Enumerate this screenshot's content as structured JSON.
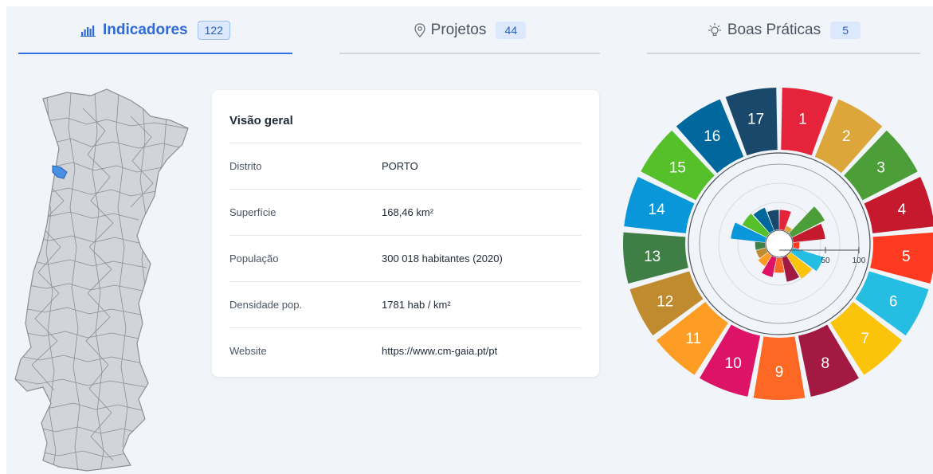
{
  "tabs": [
    {
      "label": "Indicadores",
      "count": "122",
      "icon": "bar-chart-icon",
      "active": true
    },
    {
      "label": "Projetos",
      "count": "44",
      "icon": "location-pin-icon",
      "active": false
    },
    {
      "label": "Boas Práticas",
      "count": "5",
      "icon": "lightbulb-icon",
      "active": false
    }
  ],
  "overview": {
    "title": "Visão geral",
    "rows": [
      {
        "key": "Distrito",
        "value": "PORTO"
      },
      {
        "key": "Superfície",
        "value": "168,46 km²"
      },
      {
        "key": "População",
        "value": "300 018 habitantes (2020)"
      },
      {
        "key": "Densidade pop.",
        "value": "1781 hab / km²"
      },
      {
        "key": "Website",
        "value": "https://www.cm-gaia.pt/pt"
      }
    ]
  },
  "map": {
    "highlight_color": "#4a90e2",
    "base_color": "#d1d4d8"
  },
  "sdg_wheel": {
    "scale_labels": [
      "50",
      "100"
    ],
    "goals": [
      {
        "number": "1",
        "color": "#e5243b"
      },
      {
        "number": "2",
        "color": "#dda63a"
      },
      {
        "number": "3",
        "color": "#4c9f38"
      },
      {
        "number": "4",
        "color": "#c5192d"
      },
      {
        "number": "5",
        "color": "#ff3a21"
      },
      {
        "number": "6",
        "color": "#26bde2"
      },
      {
        "number": "7",
        "color": "#fcc30b"
      },
      {
        "number": "8",
        "color": "#a21942"
      },
      {
        "number": "9",
        "color": "#fd6925"
      },
      {
        "number": "10",
        "color": "#dd1367"
      },
      {
        "number": "11",
        "color": "#fd9d24"
      },
      {
        "number": "12",
        "color": "#bf8b2e"
      },
      {
        "number": "13",
        "color": "#3f7e44"
      },
      {
        "number": "14",
        "color": "#0a97d9"
      },
      {
        "number": "15",
        "color": "#56c02b"
      },
      {
        "number": "16",
        "color": "#00689d"
      },
      {
        "number": "17",
        "color": "#19486a"
      }
    ],
    "scores": [
      40,
      10,
      75,
      65,
      12,
      65,
      55,
      50,
      30,
      40,
      25,
      20,
      20,
      70,
      55,
      50,
      40
    ]
  }
}
